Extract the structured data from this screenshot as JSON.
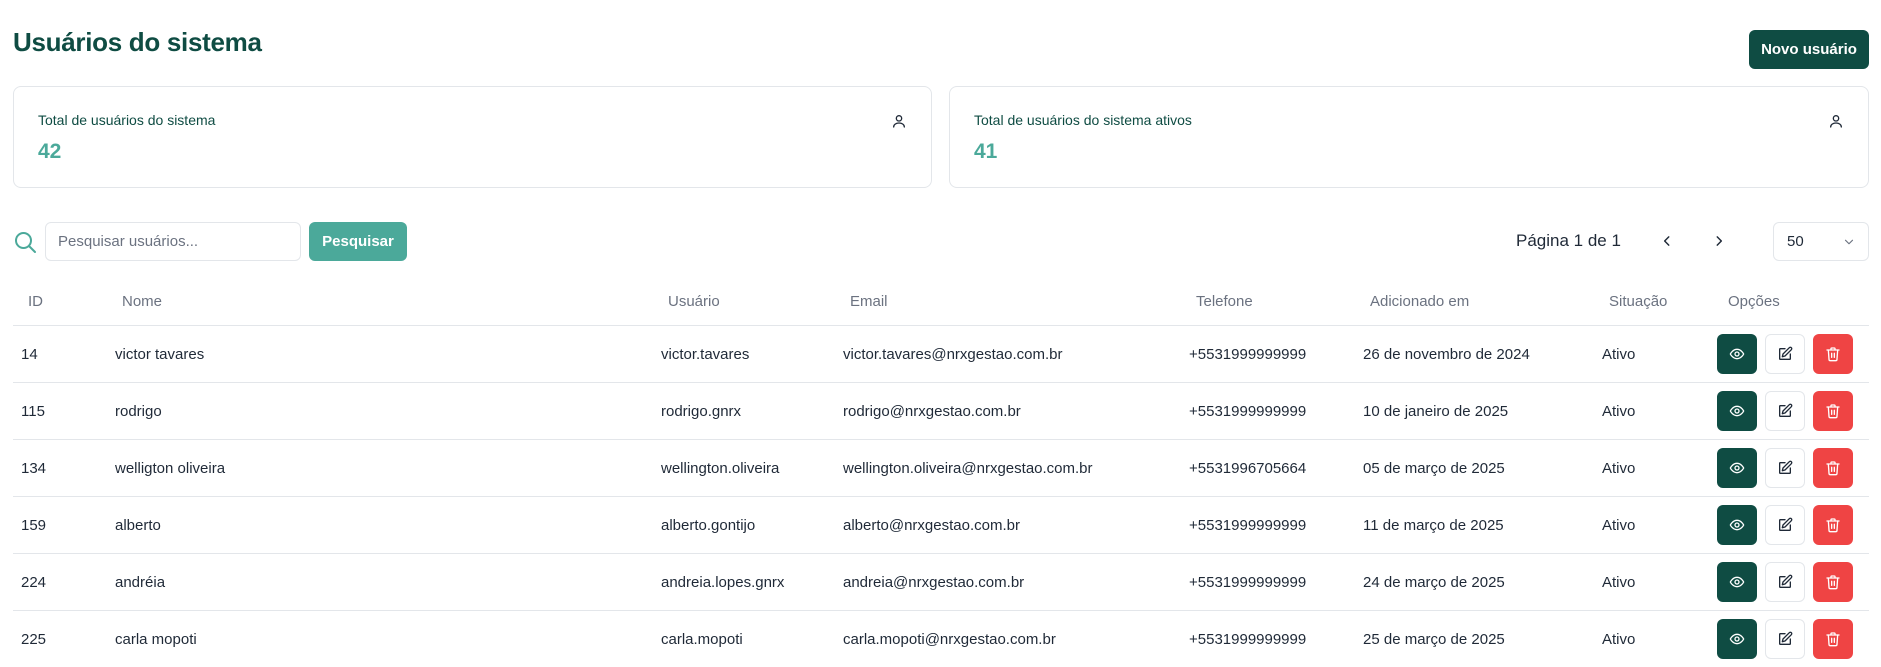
{
  "header": {
    "title": "Usuários do sistema",
    "new_user_label": "Novo usuário"
  },
  "stats": [
    {
      "label": "Total de usuários do sistema",
      "value": "42",
      "icon": "user-icon"
    },
    {
      "label": "Total de usuários do sistema ativos",
      "value": "41",
      "icon": "user-icon"
    }
  ],
  "search": {
    "placeholder": "Pesquisar usuários...",
    "value": "",
    "button_label": "Pesquisar"
  },
  "pagination": {
    "page_info": "Página 1 de 1",
    "page_size": "50"
  },
  "table": {
    "headers": [
      "ID",
      "Nome",
      "Usuário",
      "Email",
      "Telefone",
      "Adicionado em",
      "Situação",
      "Opções"
    ],
    "rows": [
      {
        "id": "14",
        "name": "victor tavares",
        "user": "victor.tavares",
        "email": "victor.tavares@nrxgestao.com.br",
        "phone": "+5531999999999",
        "added": "26 de novembro de 2024",
        "status": "Ativo"
      },
      {
        "id": "115",
        "name": "rodrigo",
        "user": "rodrigo.gnrx",
        "email": "rodrigo@nrxgestao.com.br",
        "phone": "+5531999999999",
        "added": "10 de janeiro de 2025",
        "status": "Ativo"
      },
      {
        "id": "134",
        "name": "welligton oliveira",
        "user": "wellington.oliveira",
        "email": "wellington.oliveira@nrxgestao.com.br",
        "phone": "+5531996705664",
        "added": "05 de março de 2025",
        "status": "Ativo"
      },
      {
        "id": "159",
        "name": "alberto",
        "user": "alberto.gontijo",
        "email": "alberto@nrxgestao.com.br",
        "phone": "+5531999999999",
        "added": "11 de março de 2025",
        "status": "Ativo"
      },
      {
        "id": "224",
        "name": "andréia",
        "user": "andreia.lopes.gnrx",
        "email": "andreia@nrxgestao.com.br",
        "phone": "+5531999999999",
        "added": "24 de março de 2025",
        "status": "Ativo"
      },
      {
        "id": "225",
        "name": "carla mopoti",
        "user": "carla.mopoti",
        "email": "carla.mopoti@nrxgestao.com.br",
        "phone": "+5531999999999",
        "added": "25 de março de 2025",
        "status": "Ativo"
      }
    ]
  },
  "colors": {
    "primary": "#0f4c43",
    "accent": "#4ba99a",
    "danger": "#ef4444",
    "border": "#e3e6ea"
  }
}
